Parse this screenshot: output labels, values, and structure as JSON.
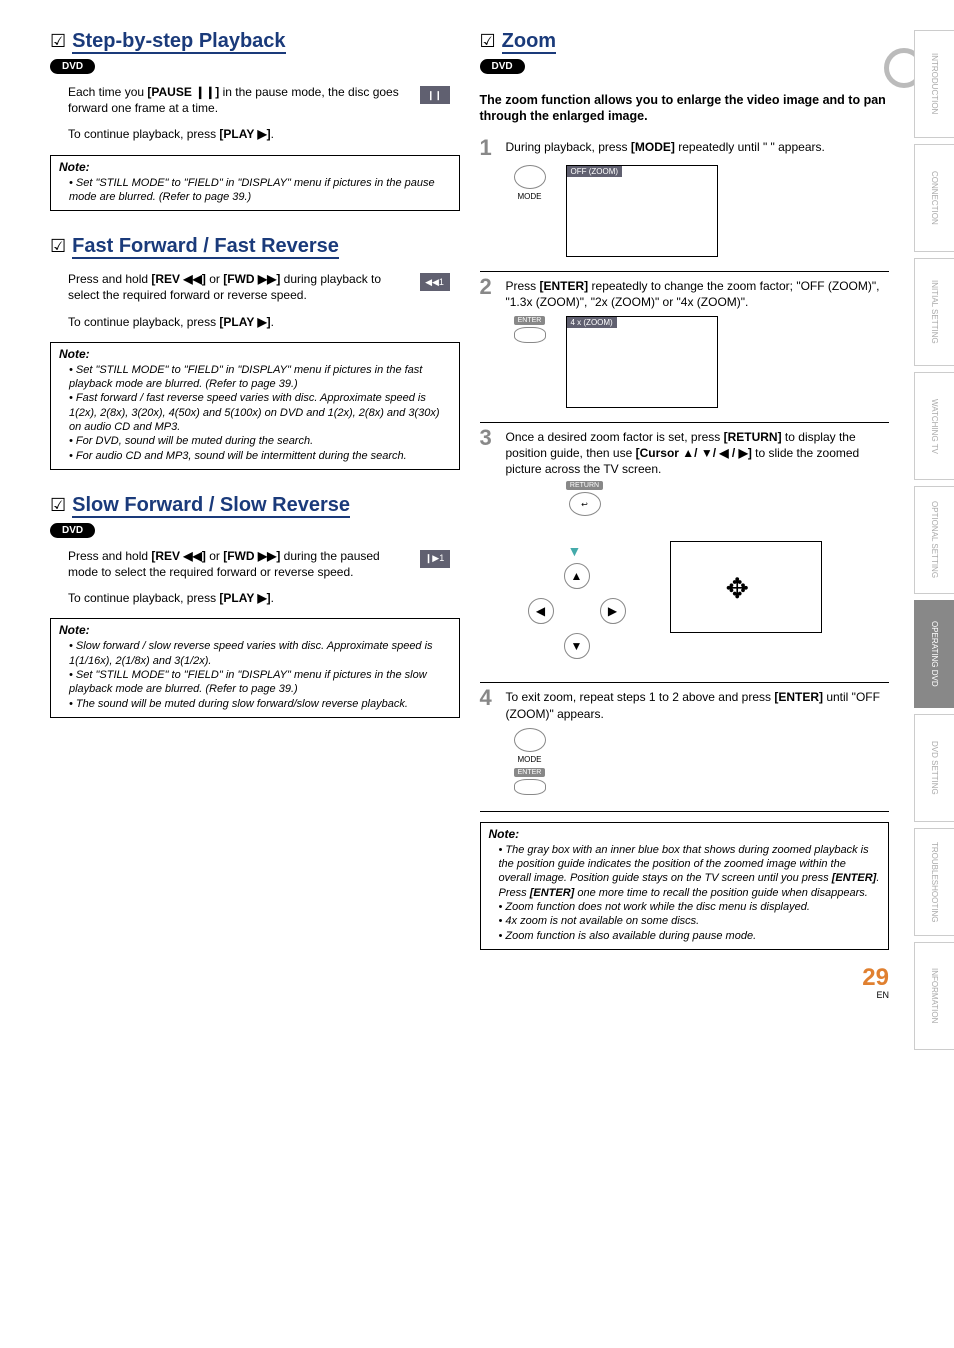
{
  "sections": {
    "step_playback": {
      "title": "Step-by-step Playback",
      "pill": "DVD",
      "para1_pre": "Each time you ",
      "para1_btn": "[PAUSE ❙❙]",
      "para1_post": " in the pause mode, the disc goes forward one frame at a time.",
      "osd_icon": "❙❙",
      "cont_pre": "To continue playback, press ",
      "cont_btn": "[PLAY ▶]",
      "cont_post": ".",
      "note_title": "Note:",
      "notes": [
        "Set \"STILL MODE\" to \"FIELD\" in \"DISPLAY\" menu if pictures in the pause mode are blurred. (Refer to page 39.)"
      ]
    },
    "fast": {
      "title": "Fast Forward / Fast Reverse",
      "para1_pre": "Press and hold ",
      "para1_btn1": "[REV ◀◀]",
      "para1_mid": " or ",
      "para1_btn2": "[FWD ▶▶]",
      "para1_post": " during playback to select the required forward or reverse speed.",
      "osd_icon": "◀◀1",
      "cont_pre": "To continue playback, press ",
      "cont_btn": "[PLAY ▶]",
      "cont_post": ".",
      "note_title": "Note:",
      "notes": [
        "Set \"STILL MODE\" to \"FIELD\" in \"DISPLAY\" menu if pictures in the fast playback mode are blurred. (Refer to page 39.)",
        "Fast forward / fast reverse speed varies with disc. Approximate speed is 1(2x), 2(8x), 3(20x), 4(50x) and 5(100x) on DVD and 1(2x), 2(8x) and 3(30x) on audio CD and MP3.",
        "For DVD, sound will be muted during the search.",
        "For audio CD and MP3, sound will be intermittent during the search."
      ]
    },
    "slow": {
      "title": "Slow Forward / Slow Reverse",
      "pill": "DVD",
      "para1_pre": "Press and hold ",
      "para1_btn1": "[REV ◀◀]",
      "para1_mid": " or ",
      "para1_btn2": "[FWD ▶▶]",
      "para1_post": " during the paused mode to select the required forward or reverse speed.",
      "osd_icon": "❙▶1",
      "cont_pre": "To continue playback, press ",
      "cont_btn": "[PLAY ▶]",
      "cont_post": ".",
      "note_title": "Note:",
      "notes": [
        "Slow forward / slow reverse speed varies with disc. Approximate speed is 1(1/16x), 2(1/8x) and 3(1/2x).",
        "Set \"STILL MODE\"  to \"FIELD\" in \"DISPLAY\" menu if pictures in the slow playback mode are blurred. (Refer to page 39.)",
        "The sound will be muted during slow forward/slow reverse playback."
      ]
    },
    "zoom": {
      "title": "Zoom",
      "pill": "DVD",
      "intro": "The zoom function allows you to enlarge the video image and to pan through the enlarged image.",
      "step1_num": "1",
      "step1_pre": "During playback, press ",
      "step1_btn": "[MODE]",
      "step1_post": " repeatedly until \"    \" appears.",
      "step1_mode_label": "MODE",
      "step1_osd": "OFF (ZOOM)",
      "step2_num": "2",
      "step2_pre": "Press ",
      "step2_btn": "[ENTER]",
      "step2_post": " repeatedly to change the zoom factor; \"OFF (ZOOM)\", \"1.3x (ZOOM)\", \"2x (ZOOM)\" or \"4x (ZOOM)\".",
      "step2_enter_label": "ENTER",
      "step2_osd": "4 x (ZOOM)",
      "step3_num": "3",
      "step3_pre": "Once a desired zoom factor is set, press ",
      "step3_btn1": "[RETURN]",
      "step3_mid": " to display the position guide, then use ",
      "step3_btn2": "[Cursor ▲/ ▼/ ◀ / ▶]",
      "step3_post": " to slide the zoomed picture across the TV screen.",
      "step3_return_label": "RETURN",
      "step4_num": "4",
      "step4_pre": "To exit zoom, repeat steps 1 to 2 above and press ",
      "step4_btn": "[ENTER]",
      "step4_post": " until \"OFF (ZOOM)\" appears.",
      "step4_mode_label": "MODE",
      "step4_enter_label": "ENTER",
      "note_title": "Note:",
      "notes_pre_enter": "The gray box with an inner blue box that shows during zoomed playback is the position guide indicates the position of the zoomed image within the overall image. Position guide stays on the TV screen until you press ",
      "notes_enter1": "[ENTER]",
      "notes_mid": ". Press ",
      "notes_enter2": "[ENTER]",
      "notes_post": " one more time to recall the position guide when disappears.",
      "notes_rest": [
        "Zoom function does not work while the disc menu is displayed.",
        "4x zoom is not available on some discs.",
        "Zoom function is also available during pause mode."
      ]
    }
  },
  "tabs": [
    "INTRODUCTION",
    "CONNECTION",
    "INITIAL SETTING",
    "WATCHING TV",
    "OPTIONAL SETTING",
    "OPERATING DVD",
    "DVD SETTING",
    "TROUBLESHOOTING",
    "INFORMATION"
  ],
  "tab_active_index": 5,
  "footer": {
    "page": "29",
    "lang": "EN"
  }
}
